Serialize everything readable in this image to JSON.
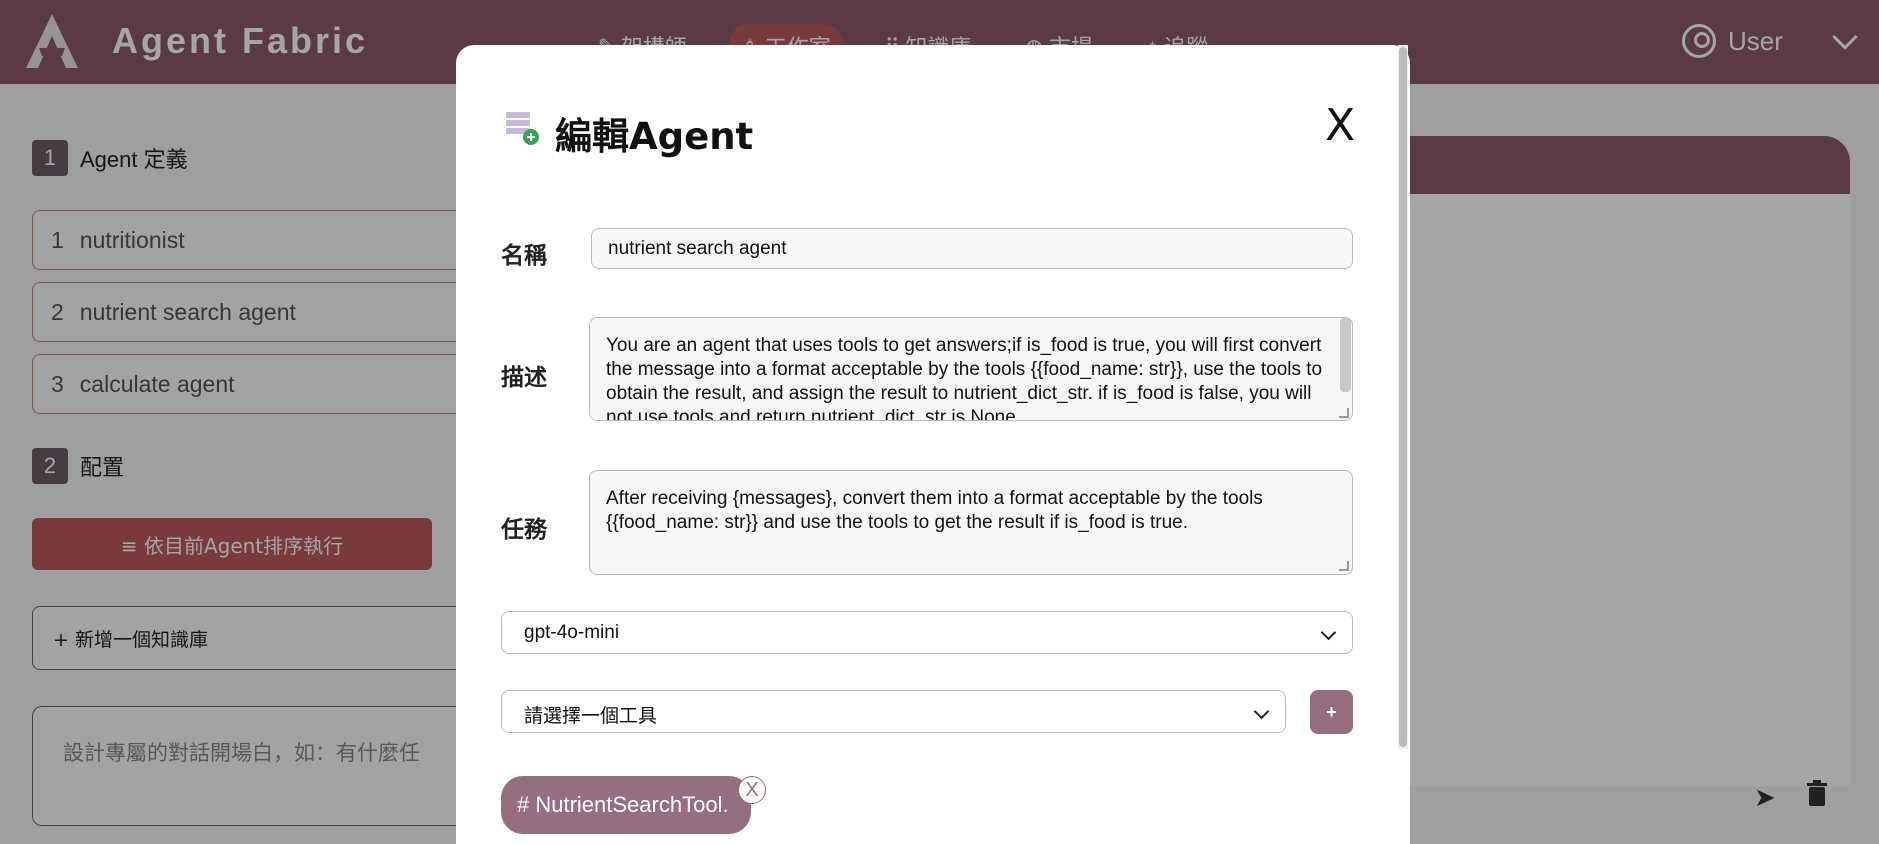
{
  "app": {
    "title": "Agent Fabric"
  },
  "nav": [
    {
      "label": "架構師",
      "icon": "wand-icon"
    },
    {
      "label": "工作室",
      "icon": "robot-icon"
    },
    {
      "label": "知識庫",
      "icon": "grid-icon"
    },
    {
      "label": "市場",
      "icon": "globe-icon"
    },
    {
      "label": "追蹤",
      "icon": "pin-icon"
    }
  ],
  "user": {
    "label": "User"
  },
  "left": {
    "section1": {
      "num": "1",
      "title": "Agent 定義"
    },
    "agents": [
      {
        "num": "1",
        "name": "nutritionist"
      },
      {
        "num": "2",
        "name": "nutrient search agent"
      },
      {
        "num": "3",
        "name": "calculate agent"
      }
    ],
    "section2": {
      "num": "2",
      "title": "配置"
    },
    "run_button": "≡ 依目前Agent排序執行",
    "add_kb": "+ 新增一個知識庫",
    "opening_placeholder": "設計專屬的對話開場白，如：有什麼任"
  },
  "modal": {
    "title": "編輯Agent",
    "close": "X",
    "name_label": "名稱",
    "name_value": "nutrient search agent",
    "desc_label": "描述",
    "desc_value": "You are an agent that uses tools to get answers;if is_food is true, you will first convert the message into a format acceptable by the tools {{food_name: str}}, use the tools to obtain the result, and assign the result to nutrient_dict_str. if is_food is false, you will not use tools and return nutrient_dict_str is None.",
    "task_label": "任務",
    "task_value": "After receiving {messages}, convert them into a format acceptable by the tools {{food_name: str}} and use the tools to get the result if is_food is true.",
    "model_selected": "gpt-4o-mini",
    "tool_placeholder": "請選擇一個工具",
    "add_tool": "+",
    "tool_chip": "# NutrientSearchTool.",
    "chip_remove": "X"
  },
  "colors": {
    "primary": "#8a5a6a",
    "accent": "#b85a5a",
    "chip": "#956e80"
  }
}
